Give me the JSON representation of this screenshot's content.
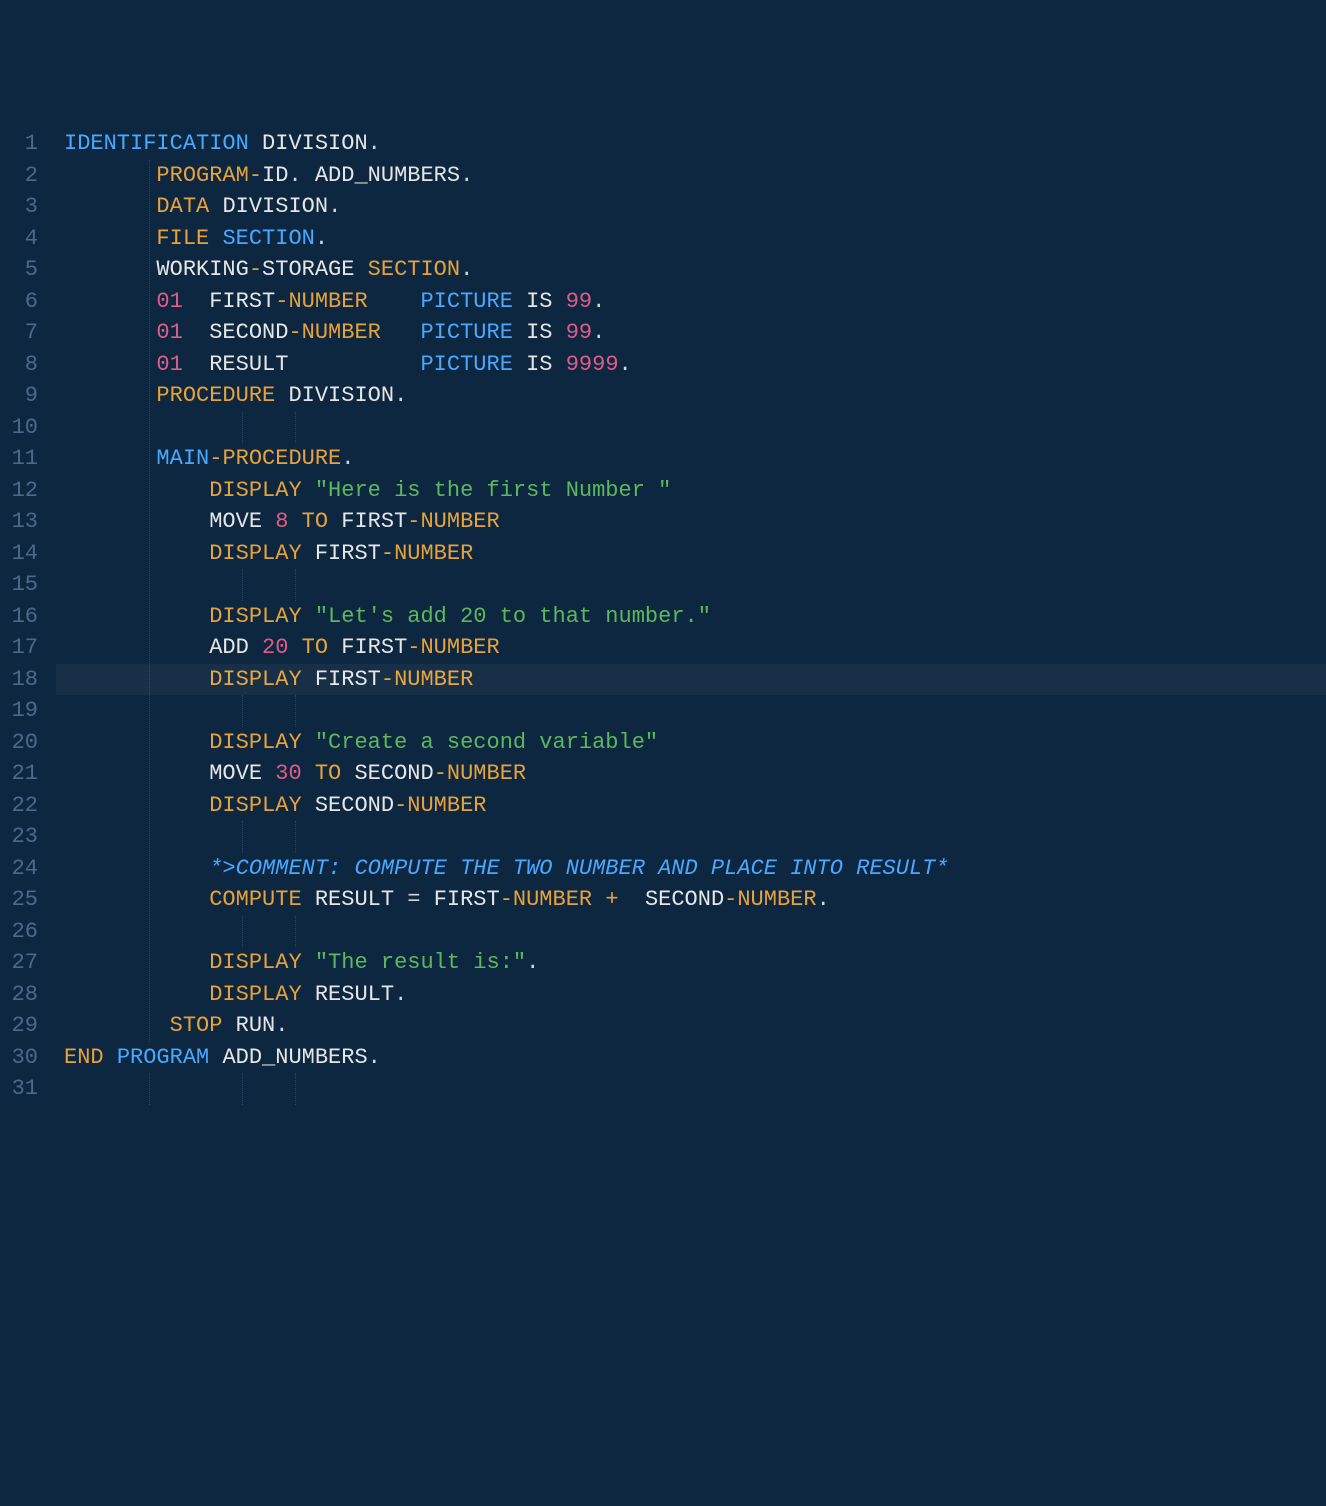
{
  "editor": {
    "active_line": 18,
    "indent_cols": [
      7,
      14,
      18
    ],
    "lines": [
      {
        "n": 1,
        "tokens": [
          {
            "t": "IDENTIFICATION",
            "c": "tok-kw2"
          },
          {
            "t": " ",
            "c": ""
          },
          {
            "t": "DIVISION",
            "c": "tok-ident"
          },
          {
            "t": ".",
            "c": "tok-punct"
          }
        ]
      },
      {
        "n": 2,
        "tokens": [
          {
            "t": "       ",
            "c": ""
          },
          {
            "t": "PROGRAM",
            "c": "tok-kw1"
          },
          {
            "t": "-",
            "c": "tok-op"
          },
          {
            "t": "ID",
            "c": "tok-ident"
          },
          {
            "t": ". ",
            "c": "tok-punct"
          },
          {
            "t": "ADD_NUMBERS",
            "c": "tok-ident"
          },
          {
            "t": ".",
            "c": "tok-punct"
          }
        ]
      },
      {
        "n": 3,
        "tokens": [
          {
            "t": "       ",
            "c": ""
          },
          {
            "t": "DATA",
            "c": "tok-kw1"
          },
          {
            "t": " ",
            "c": ""
          },
          {
            "t": "DIVISION",
            "c": "tok-ident"
          },
          {
            "t": ".",
            "c": "tok-punct"
          }
        ]
      },
      {
        "n": 4,
        "tokens": [
          {
            "t": "       ",
            "c": ""
          },
          {
            "t": "FILE",
            "c": "tok-kw1"
          },
          {
            "t": " ",
            "c": ""
          },
          {
            "t": "SECTION",
            "c": "tok-kw2"
          },
          {
            "t": ".",
            "c": "tok-punct"
          }
        ]
      },
      {
        "n": 5,
        "tokens": [
          {
            "t": "       ",
            "c": ""
          },
          {
            "t": "WORKING",
            "c": "tok-ident"
          },
          {
            "t": "-",
            "c": "tok-op"
          },
          {
            "t": "STORAGE",
            "c": "tok-ident"
          },
          {
            "t": " ",
            "c": ""
          },
          {
            "t": "SECTION",
            "c": "tok-kw1"
          },
          {
            "t": ".",
            "c": "tok-punct"
          }
        ]
      },
      {
        "n": 6,
        "tokens": [
          {
            "t": "       ",
            "c": ""
          },
          {
            "t": "01",
            "c": "tok-num"
          },
          {
            "t": "  ",
            "c": ""
          },
          {
            "t": "FIRST",
            "c": "tok-ident"
          },
          {
            "t": "-",
            "c": "tok-op"
          },
          {
            "t": "NUMBER",
            "c": "tok-kw1"
          },
          {
            "t": "    ",
            "c": ""
          },
          {
            "t": "PICTURE",
            "c": "tok-kw2"
          },
          {
            "t": " ",
            "c": ""
          },
          {
            "t": "IS",
            "c": "tok-ident"
          },
          {
            "t": " ",
            "c": ""
          },
          {
            "t": "99",
            "c": "tok-num"
          },
          {
            "t": ".",
            "c": "tok-punct"
          }
        ]
      },
      {
        "n": 7,
        "tokens": [
          {
            "t": "       ",
            "c": ""
          },
          {
            "t": "01",
            "c": "tok-num"
          },
          {
            "t": "  ",
            "c": ""
          },
          {
            "t": "SECOND",
            "c": "tok-ident"
          },
          {
            "t": "-",
            "c": "tok-op"
          },
          {
            "t": "NUMBER",
            "c": "tok-kw1"
          },
          {
            "t": "   ",
            "c": ""
          },
          {
            "t": "PICTURE",
            "c": "tok-kw2"
          },
          {
            "t": " ",
            "c": ""
          },
          {
            "t": "IS",
            "c": "tok-ident"
          },
          {
            "t": " ",
            "c": ""
          },
          {
            "t": "99",
            "c": "tok-num"
          },
          {
            "t": ".",
            "c": "tok-punct"
          }
        ]
      },
      {
        "n": 8,
        "tokens": [
          {
            "t": "       ",
            "c": ""
          },
          {
            "t": "01",
            "c": "tok-num"
          },
          {
            "t": "  ",
            "c": ""
          },
          {
            "t": "RESULT",
            "c": "tok-ident"
          },
          {
            "t": "          ",
            "c": ""
          },
          {
            "t": "PICTURE",
            "c": "tok-kw2"
          },
          {
            "t": " ",
            "c": ""
          },
          {
            "t": "IS",
            "c": "tok-ident"
          },
          {
            "t": " ",
            "c": ""
          },
          {
            "t": "9999",
            "c": "tok-num"
          },
          {
            "t": ".",
            "c": "tok-punct"
          }
        ]
      },
      {
        "n": 9,
        "tokens": [
          {
            "t": "       ",
            "c": ""
          },
          {
            "t": "PROCEDURE",
            "c": "tok-kw1"
          },
          {
            "t": " ",
            "c": ""
          },
          {
            "t": "DIVISION",
            "c": "tok-ident"
          },
          {
            "t": ".",
            "c": "tok-punct"
          }
        ]
      },
      {
        "n": 10,
        "tokens": []
      },
      {
        "n": 11,
        "tokens": [
          {
            "t": "       ",
            "c": ""
          },
          {
            "t": "MAIN",
            "c": "tok-kw2"
          },
          {
            "t": "-",
            "c": "tok-op"
          },
          {
            "t": "PROCEDURE",
            "c": "tok-kw1"
          },
          {
            "t": ".",
            "c": "tok-punct"
          }
        ]
      },
      {
        "n": 12,
        "tokens": [
          {
            "t": "           ",
            "c": ""
          },
          {
            "t": "DISPLAY",
            "c": "tok-kw1"
          },
          {
            "t": " ",
            "c": ""
          },
          {
            "t": "\"Here is the first Number \"",
            "c": "tok-str"
          }
        ]
      },
      {
        "n": 13,
        "tokens": [
          {
            "t": "           ",
            "c": ""
          },
          {
            "t": "MOVE",
            "c": "tok-ident"
          },
          {
            "t": " ",
            "c": ""
          },
          {
            "t": "8",
            "c": "tok-num"
          },
          {
            "t": " ",
            "c": ""
          },
          {
            "t": "TO",
            "c": "tok-kw1"
          },
          {
            "t": " ",
            "c": ""
          },
          {
            "t": "FIRST",
            "c": "tok-ident"
          },
          {
            "t": "-",
            "c": "tok-op"
          },
          {
            "t": "NUMBER",
            "c": "tok-kw1"
          }
        ]
      },
      {
        "n": 14,
        "tokens": [
          {
            "t": "           ",
            "c": ""
          },
          {
            "t": "DISPLAY",
            "c": "tok-kw1"
          },
          {
            "t": " ",
            "c": ""
          },
          {
            "t": "FIRST",
            "c": "tok-ident"
          },
          {
            "t": "-",
            "c": "tok-op"
          },
          {
            "t": "NUMBER",
            "c": "tok-kw1"
          }
        ]
      },
      {
        "n": 15,
        "tokens": []
      },
      {
        "n": 16,
        "tokens": [
          {
            "t": "           ",
            "c": ""
          },
          {
            "t": "DISPLAY",
            "c": "tok-kw1"
          },
          {
            "t": " ",
            "c": ""
          },
          {
            "t": "\"Let's add 20 to that number.\"",
            "c": "tok-str"
          }
        ]
      },
      {
        "n": 17,
        "tokens": [
          {
            "t": "           ",
            "c": ""
          },
          {
            "t": "ADD",
            "c": "tok-ident"
          },
          {
            "t": " ",
            "c": ""
          },
          {
            "t": "20",
            "c": "tok-num"
          },
          {
            "t": " ",
            "c": ""
          },
          {
            "t": "TO",
            "c": "tok-kw1"
          },
          {
            "t": " ",
            "c": ""
          },
          {
            "t": "FIRST",
            "c": "tok-ident"
          },
          {
            "t": "-",
            "c": "tok-op"
          },
          {
            "t": "NUMBER",
            "c": "tok-kw1"
          }
        ]
      },
      {
        "n": 18,
        "tokens": [
          {
            "t": "           ",
            "c": ""
          },
          {
            "t": "DISPLAY",
            "c": "tok-kw1"
          },
          {
            "t": " ",
            "c": ""
          },
          {
            "t": "FIRST",
            "c": "tok-ident"
          },
          {
            "t": "-",
            "c": "tok-op"
          },
          {
            "t": "NUMBER",
            "c": "tok-kw1"
          }
        ]
      },
      {
        "n": 19,
        "tokens": []
      },
      {
        "n": 20,
        "tokens": [
          {
            "t": "           ",
            "c": ""
          },
          {
            "t": "DISPLAY",
            "c": "tok-kw1"
          },
          {
            "t": " ",
            "c": ""
          },
          {
            "t": "\"Create a second variable\"",
            "c": "tok-str"
          }
        ]
      },
      {
        "n": 21,
        "tokens": [
          {
            "t": "           ",
            "c": ""
          },
          {
            "t": "MOVE",
            "c": "tok-ident"
          },
          {
            "t": " ",
            "c": ""
          },
          {
            "t": "30",
            "c": "tok-num"
          },
          {
            "t": " ",
            "c": ""
          },
          {
            "t": "TO",
            "c": "tok-kw1"
          },
          {
            "t": " ",
            "c": ""
          },
          {
            "t": "SECOND",
            "c": "tok-ident"
          },
          {
            "t": "-",
            "c": "tok-op"
          },
          {
            "t": "NUMBER",
            "c": "tok-kw1"
          }
        ]
      },
      {
        "n": 22,
        "tokens": [
          {
            "t": "           ",
            "c": ""
          },
          {
            "t": "DISPLAY",
            "c": "tok-kw1"
          },
          {
            "t": " ",
            "c": ""
          },
          {
            "t": "SECOND",
            "c": "tok-ident"
          },
          {
            "t": "-",
            "c": "tok-op"
          },
          {
            "t": "NUMBER",
            "c": "tok-kw1"
          }
        ]
      },
      {
        "n": 23,
        "tokens": []
      },
      {
        "n": 24,
        "tokens": [
          {
            "t": "           ",
            "c": ""
          },
          {
            "t": "*>COMMENT: COMPUTE THE TWO NUMBER AND PLACE INTO RESULT*",
            "c": "tok-comment"
          }
        ]
      },
      {
        "n": 25,
        "tokens": [
          {
            "t": "           ",
            "c": ""
          },
          {
            "t": "COMPUTE",
            "c": "tok-kw1"
          },
          {
            "t": " ",
            "c": ""
          },
          {
            "t": "RESULT",
            "c": "tok-ident"
          },
          {
            "t": " ",
            "c": ""
          },
          {
            "t": "=",
            "c": "tok-punct"
          },
          {
            "t": " ",
            "c": ""
          },
          {
            "t": "FIRST",
            "c": "tok-ident"
          },
          {
            "t": "-",
            "c": "tok-op"
          },
          {
            "t": "NUMBER",
            "c": "tok-kw1"
          },
          {
            "t": " ",
            "c": ""
          },
          {
            "t": "+",
            "c": "tok-op"
          },
          {
            "t": "  ",
            "c": ""
          },
          {
            "t": "SECOND",
            "c": "tok-ident"
          },
          {
            "t": "-",
            "c": "tok-op"
          },
          {
            "t": "NUMBER",
            "c": "tok-kw1"
          },
          {
            "t": ".",
            "c": "tok-punct"
          }
        ]
      },
      {
        "n": 26,
        "tokens": []
      },
      {
        "n": 27,
        "tokens": [
          {
            "t": "           ",
            "c": ""
          },
          {
            "t": "DISPLAY",
            "c": "tok-kw1"
          },
          {
            "t": " ",
            "c": ""
          },
          {
            "t": "\"The result is:\"",
            "c": "tok-str"
          },
          {
            "t": ".",
            "c": "tok-punct"
          }
        ]
      },
      {
        "n": 28,
        "tokens": [
          {
            "t": "           ",
            "c": ""
          },
          {
            "t": "DISPLAY",
            "c": "tok-kw1"
          },
          {
            "t": " ",
            "c": ""
          },
          {
            "t": "RESULT",
            "c": "tok-ident"
          },
          {
            "t": ".",
            "c": "tok-punct"
          }
        ]
      },
      {
        "n": 29,
        "tokens": [
          {
            "t": "        ",
            "c": ""
          },
          {
            "t": "STOP",
            "c": "tok-kw1"
          },
          {
            "t": " ",
            "c": ""
          },
          {
            "t": "RUN",
            "c": "tok-ident"
          },
          {
            "t": ".",
            "c": "tok-punct"
          }
        ]
      },
      {
        "n": 30,
        "tokens": [
          {
            "t": "END",
            "c": "tok-kw1"
          },
          {
            "t": " ",
            "c": ""
          },
          {
            "t": "PROGRAM",
            "c": "tok-kw2"
          },
          {
            "t": " ",
            "c": ""
          },
          {
            "t": "ADD_NUMBERS",
            "c": "tok-ident"
          },
          {
            "t": ".",
            "c": "tok-punct"
          }
        ]
      },
      {
        "n": 31,
        "tokens": []
      }
    ]
  }
}
